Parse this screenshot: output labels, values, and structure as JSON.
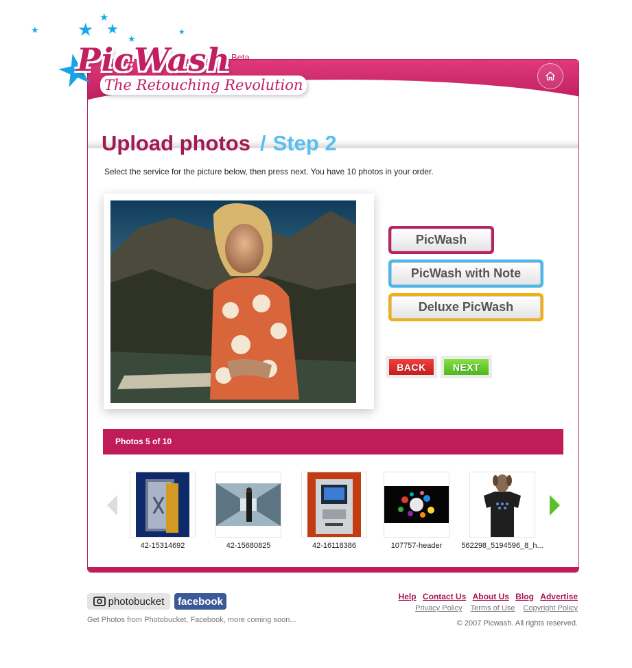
{
  "logo": {
    "name": "PicWash",
    "beta": "Beta",
    "tagline": "The Retouching Revolution"
  },
  "header": {
    "home_icon": "home-icon"
  },
  "page": {
    "title": "Upload photos",
    "separator": "/",
    "step": "Step 2",
    "instructions": "Select the service for the picture below, then press next. You have 10 photos in your order."
  },
  "services": {
    "picwash": "PicWash",
    "picwash_note": "PicWash with Note",
    "deluxe": "Deluxe PicWash"
  },
  "nav": {
    "back": "BACK",
    "next": "NEXT"
  },
  "photos_bar": {
    "label": "Photos 5 of 10"
  },
  "thumbnails": [
    {
      "label": "42-15314692"
    },
    {
      "label": "42-15680825"
    },
    {
      "label": "42-16118386"
    },
    {
      "label": "107757-header"
    },
    {
      "label": "562298_5194596_8_h..."
    }
  ],
  "footer": {
    "photobucket": "photobucket",
    "facebook": "facebook",
    "note": "Get Photos from Photobucket, Facebook, more coming soon...",
    "links": {
      "help": "Help",
      "contact": "Contact Us",
      "about": "About Us",
      "blog": "Blog",
      "advertise": "Advertise"
    },
    "legal": {
      "privacy": "Privacy Policy",
      "terms": "Terms of Use",
      "copyright_policy": "Copyright Policy"
    },
    "copyright": "© 2007 Picwash. All rights reserved."
  },
  "colors": {
    "brand": "#c01c5a",
    "accent_blue": "#48b8ef",
    "accent_gold": "#f0b013",
    "back_red": "#d42a2a",
    "next_green": "#5cbf2a"
  }
}
